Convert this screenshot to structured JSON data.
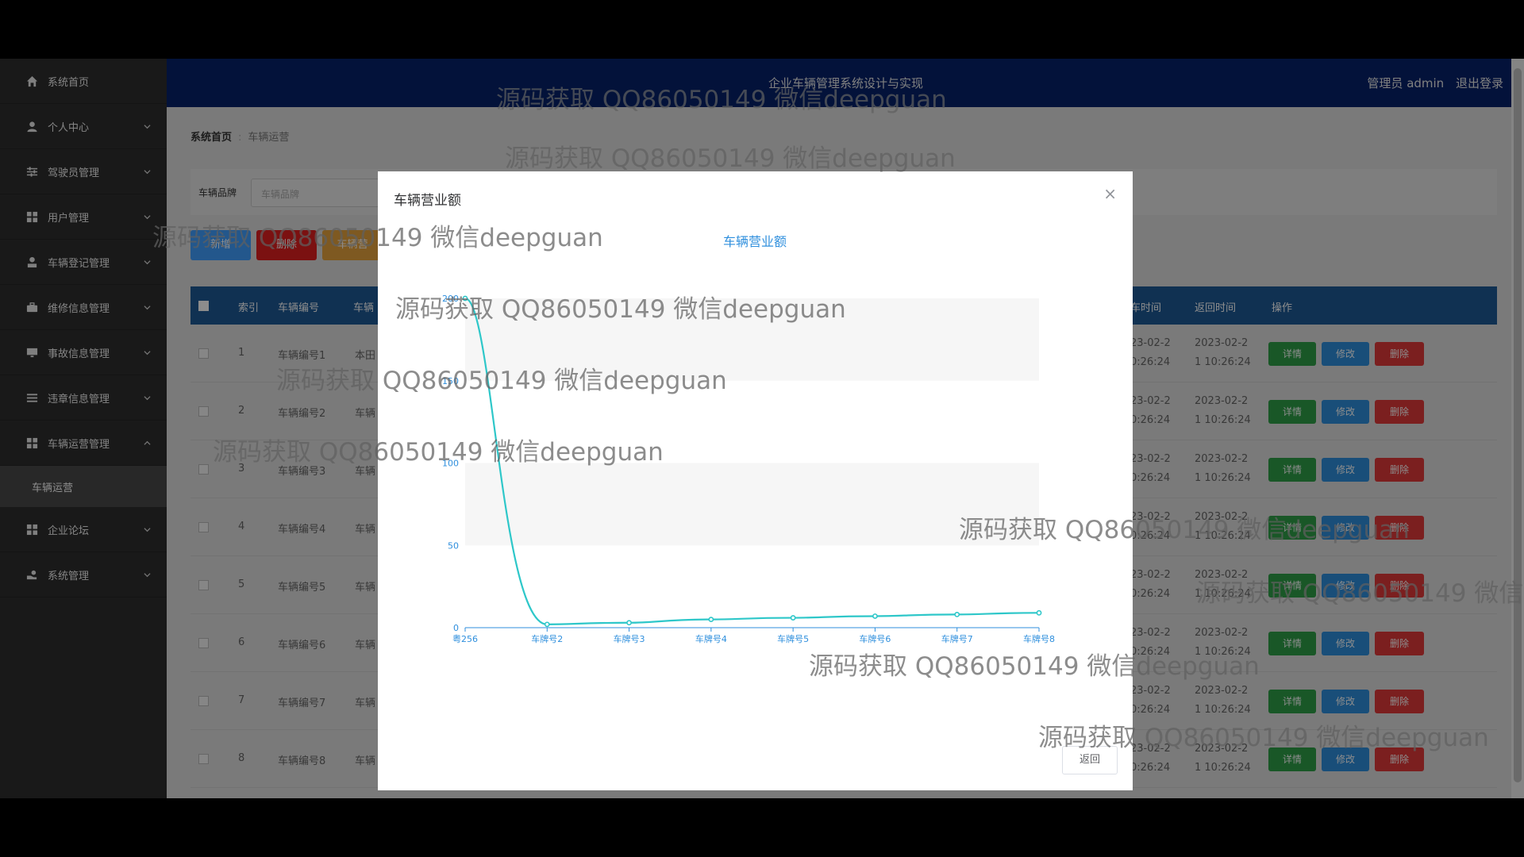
{
  "sidebar": {
    "items": [
      {
        "label": "系统首页",
        "icon": "home-icon",
        "expandable": false
      },
      {
        "label": "个人中心",
        "icon": "user-icon",
        "expandable": true
      },
      {
        "label": "驾驶员管理",
        "icon": "sliders-icon",
        "expandable": true
      },
      {
        "label": "用户管理",
        "icon": "grid-icon",
        "expandable": true
      },
      {
        "label": "车辆登记管理",
        "icon": "person-icon",
        "expandable": true
      },
      {
        "label": "维修信息管理",
        "icon": "briefcase-icon",
        "expandable": true
      },
      {
        "label": "事故信息管理",
        "icon": "monitor-icon",
        "expandable": true
      },
      {
        "label": "违章信息管理",
        "icon": "list-icon",
        "expandable": true
      },
      {
        "label": "车辆运营管理",
        "icon": "grid-icon",
        "expandable": true,
        "expanded": true
      },
      {
        "label": "企业论坛",
        "icon": "grid-icon",
        "expandable": true
      },
      {
        "label": "系统管理",
        "icon": "gear-hand-icon",
        "expandable": true
      }
    ],
    "sub_item": "车辆运营"
  },
  "header": {
    "title": "企业车辆管理系统设计与实现",
    "user": "管理员 admin",
    "logout": "退出登录"
  },
  "breadcrumb": {
    "home": "系统首页",
    "current": "车辆运营"
  },
  "search": {
    "label": "车辆品牌",
    "placeholder": "车辆品牌"
  },
  "buttons": {
    "add": "新增",
    "delete": "删除",
    "chart": "车辆营"
  },
  "table": {
    "headers": {
      "index": "索引",
      "code": "车辆编号",
      "brand": "车辆",
      "out_time": "车时间",
      "return_time": "返回时间",
      "ops": "操作"
    },
    "rows": [
      {
        "index": "1",
        "code": "车辆编号1",
        "brand": "本田",
        "out1": "23-02-2",
        "out2": "0:26:24",
        "ret1": "2023-02-2",
        "ret2": "1 10:26:24"
      },
      {
        "index": "2",
        "code": "车辆编号2",
        "brand": "车辆",
        "out1": "23-02-2",
        "out2": "0:26:24",
        "ret1": "2023-02-2",
        "ret2": "1 10:26:24"
      },
      {
        "index": "3",
        "code": "车辆编号3",
        "brand": "车辆",
        "out1": "23-02-2",
        "out2": "0:26:24",
        "ret1": "2023-02-2",
        "ret2": "1 10:26:24"
      },
      {
        "index": "4",
        "code": "车辆编号4",
        "brand": "车辆",
        "out1": "23-02-2",
        "out2": "0:26:24",
        "ret1": "2023-02-2",
        "ret2": "1 10:26:24"
      },
      {
        "index": "5",
        "code": "车辆编号5",
        "brand": "车辆",
        "out1": "23-02-2",
        "out2": "0:26:24",
        "ret1": "2023-02-2",
        "ret2": "1 10:26:24"
      },
      {
        "index": "6",
        "code": "车辆编号6",
        "brand": "车辆",
        "out1": "23-02-2",
        "out2": "0:26:24",
        "ret1": "2023-02-2",
        "ret2": "1 10:26:24"
      },
      {
        "index": "7",
        "code": "车辆编号7",
        "brand": "车辆",
        "out1": "23-02-2",
        "out2": "0:26:24",
        "ret1": "2023-02-2",
        "ret2": "1 10:26:24"
      },
      {
        "index": "8",
        "code": "车辆编号8",
        "brand": "车辆",
        "out1": "23-02-2",
        "out2": "0:26:24",
        "ret1": "2023-02-2",
        "ret2": "1 10:26:24"
      }
    ],
    "actions": {
      "detail": "详情",
      "edit": "修改",
      "delete": "删除"
    }
  },
  "modal": {
    "title": "车辆营业额",
    "close": "×",
    "back": "返回"
  },
  "chart_data": {
    "type": "line",
    "title": "车辆营业额",
    "categories": [
      "粤256",
      "车牌号2",
      "车牌号3",
      "车牌号4",
      "车牌号5",
      "车牌号6",
      "车牌号7",
      "车牌号8"
    ],
    "values": [
      200,
      2,
      3,
      5,
      6,
      7,
      8,
      9
    ],
    "yticks": [
      0,
      50,
      100,
      150,
      200
    ],
    "ylim": [
      0,
      200
    ],
    "smooth": true,
    "color": "#2ec7c9"
  },
  "watermark": "源码获取 QQ86050149 微信deepguan",
  "colors": {
    "header": "#06226b",
    "sidebar": "#2e2e2e",
    "table_header": "#1e5a96",
    "btn_add": "#409eff",
    "btn_delete": "#e02020",
    "btn_chart": "#e6a23c",
    "op_detail": "#2e9e48",
    "op_edit": "#2f8fdd",
    "op_delete": "#e03a3a"
  }
}
